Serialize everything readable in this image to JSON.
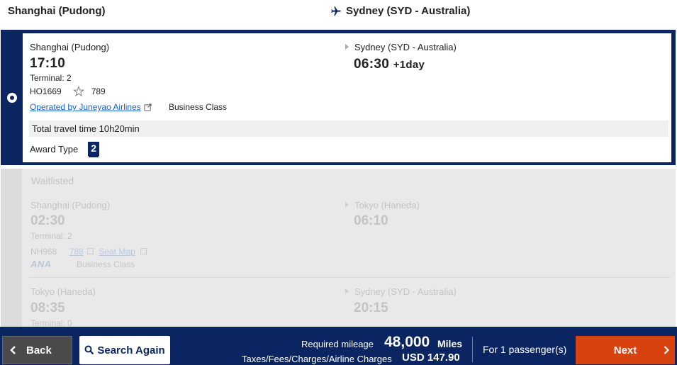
{
  "header": {
    "origin": "Shanghai (Pudong)",
    "destination": "Sydney (SYD - Australia)"
  },
  "selected_flight": {
    "departure": {
      "city": "Shanghai (Pudong)",
      "time": "17:10",
      "terminal": "Terminal: 2"
    },
    "arrival": {
      "city": "Sydney (SYD - Australia)",
      "time": "06:30",
      "day_offset": "+1day"
    },
    "flight_number": "HO1669",
    "aircraft": "789",
    "operated_by": "Operated by Juneyao Airlines",
    "cabin": "Business Class",
    "total_travel_time": "Total travel time 10h20min",
    "award_type_label": "Award Type",
    "award_type_value": "2"
  },
  "waitlisted_flight": {
    "status": "Waitlisted",
    "segment1": {
      "departure": {
        "city": "Shanghai (Pudong)",
        "time": "02:30",
        "terminal": "Terminal: 2"
      },
      "arrival": {
        "city": "Tokyo (Haneda)",
        "time": "06:10"
      },
      "flight_number": "NH968",
      "aircraft": "788",
      "seat_map": "Seat Map",
      "airline_logo": "ANA",
      "cabin": "Business Class"
    },
    "segment2": {
      "departure": {
        "city": "Tokyo (Haneda)",
        "time": "08:35",
        "terminal": "Terminal: 0"
      },
      "arrival": {
        "city": "Sydney (SYD - Australia)",
        "time": "20:15"
      }
    }
  },
  "footer": {
    "back_label": "Back",
    "search_again_label": "Search Again",
    "required_mileage_label": "Required mileage",
    "mileage_value": "48,000",
    "mileage_unit": "Miles",
    "taxes_label": "Taxes/Fees/Charges/Airline Charges",
    "taxes_value": "USD 147.90",
    "passengers_label": "For 1 passenger(s)",
    "next_label": "Next"
  },
  "colors": {
    "navy": "#0a2561",
    "next_orange": "#d8420f",
    "link_blue": "#1a64c8"
  }
}
